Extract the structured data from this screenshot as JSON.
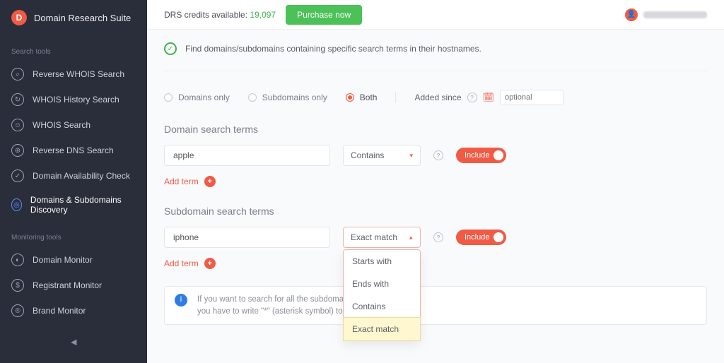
{
  "brand": {
    "title": "Domain Research Suite",
    "initial": "D"
  },
  "sidebar": {
    "sections": {
      "search_label": "Search tools",
      "monitor_label": "Monitoring tools"
    },
    "search_items": [
      {
        "label": "Reverse WHOIS Search"
      },
      {
        "label": "WHOIS History Search"
      },
      {
        "label": "WHOIS Search"
      },
      {
        "label": "Reverse DNS Search"
      },
      {
        "label": "Domain Availability Check"
      },
      {
        "label": "Domains & Subdomains Discovery"
      }
    ],
    "monitor_items": [
      {
        "label": "Domain Monitor"
      },
      {
        "label": "Registrant Monitor"
      },
      {
        "label": "Brand Monitor"
      }
    ]
  },
  "topbar": {
    "credits_label": "DRS credits available:",
    "credits_value": "19,097",
    "purchase_label": "Purchase now"
  },
  "desc": "Find domains/subdomains containing specific search terms in their hostnames.",
  "scope": {
    "options": [
      {
        "label": "Domains only"
      },
      {
        "label": "Subdomains only"
      },
      {
        "label": "Both"
      }
    ],
    "selected_index": 2,
    "added_since_label": "Added since",
    "date_placeholder": "optional"
  },
  "domain_terms": {
    "title": "Domain search terms",
    "value": "apple",
    "match_type": "Contains",
    "include_label": "Include",
    "add_label": "Add term"
  },
  "subdomain_terms": {
    "title": "Subdomain search terms",
    "value": "iphone",
    "match_type": "Exact match",
    "include_label": "Include",
    "add_label": "Add term"
  },
  "match_dropdown": {
    "options": [
      "Starts with",
      "Ends with",
      "Contains",
      "Exact match"
    ],
    "selected": "Exact match"
  },
  "tip": {
    "line1": "If you want to search for all the subdomains of the pa",
    "line2": "you have to write \"*\" (asterisk symbol) to the \"Subdo"
  }
}
